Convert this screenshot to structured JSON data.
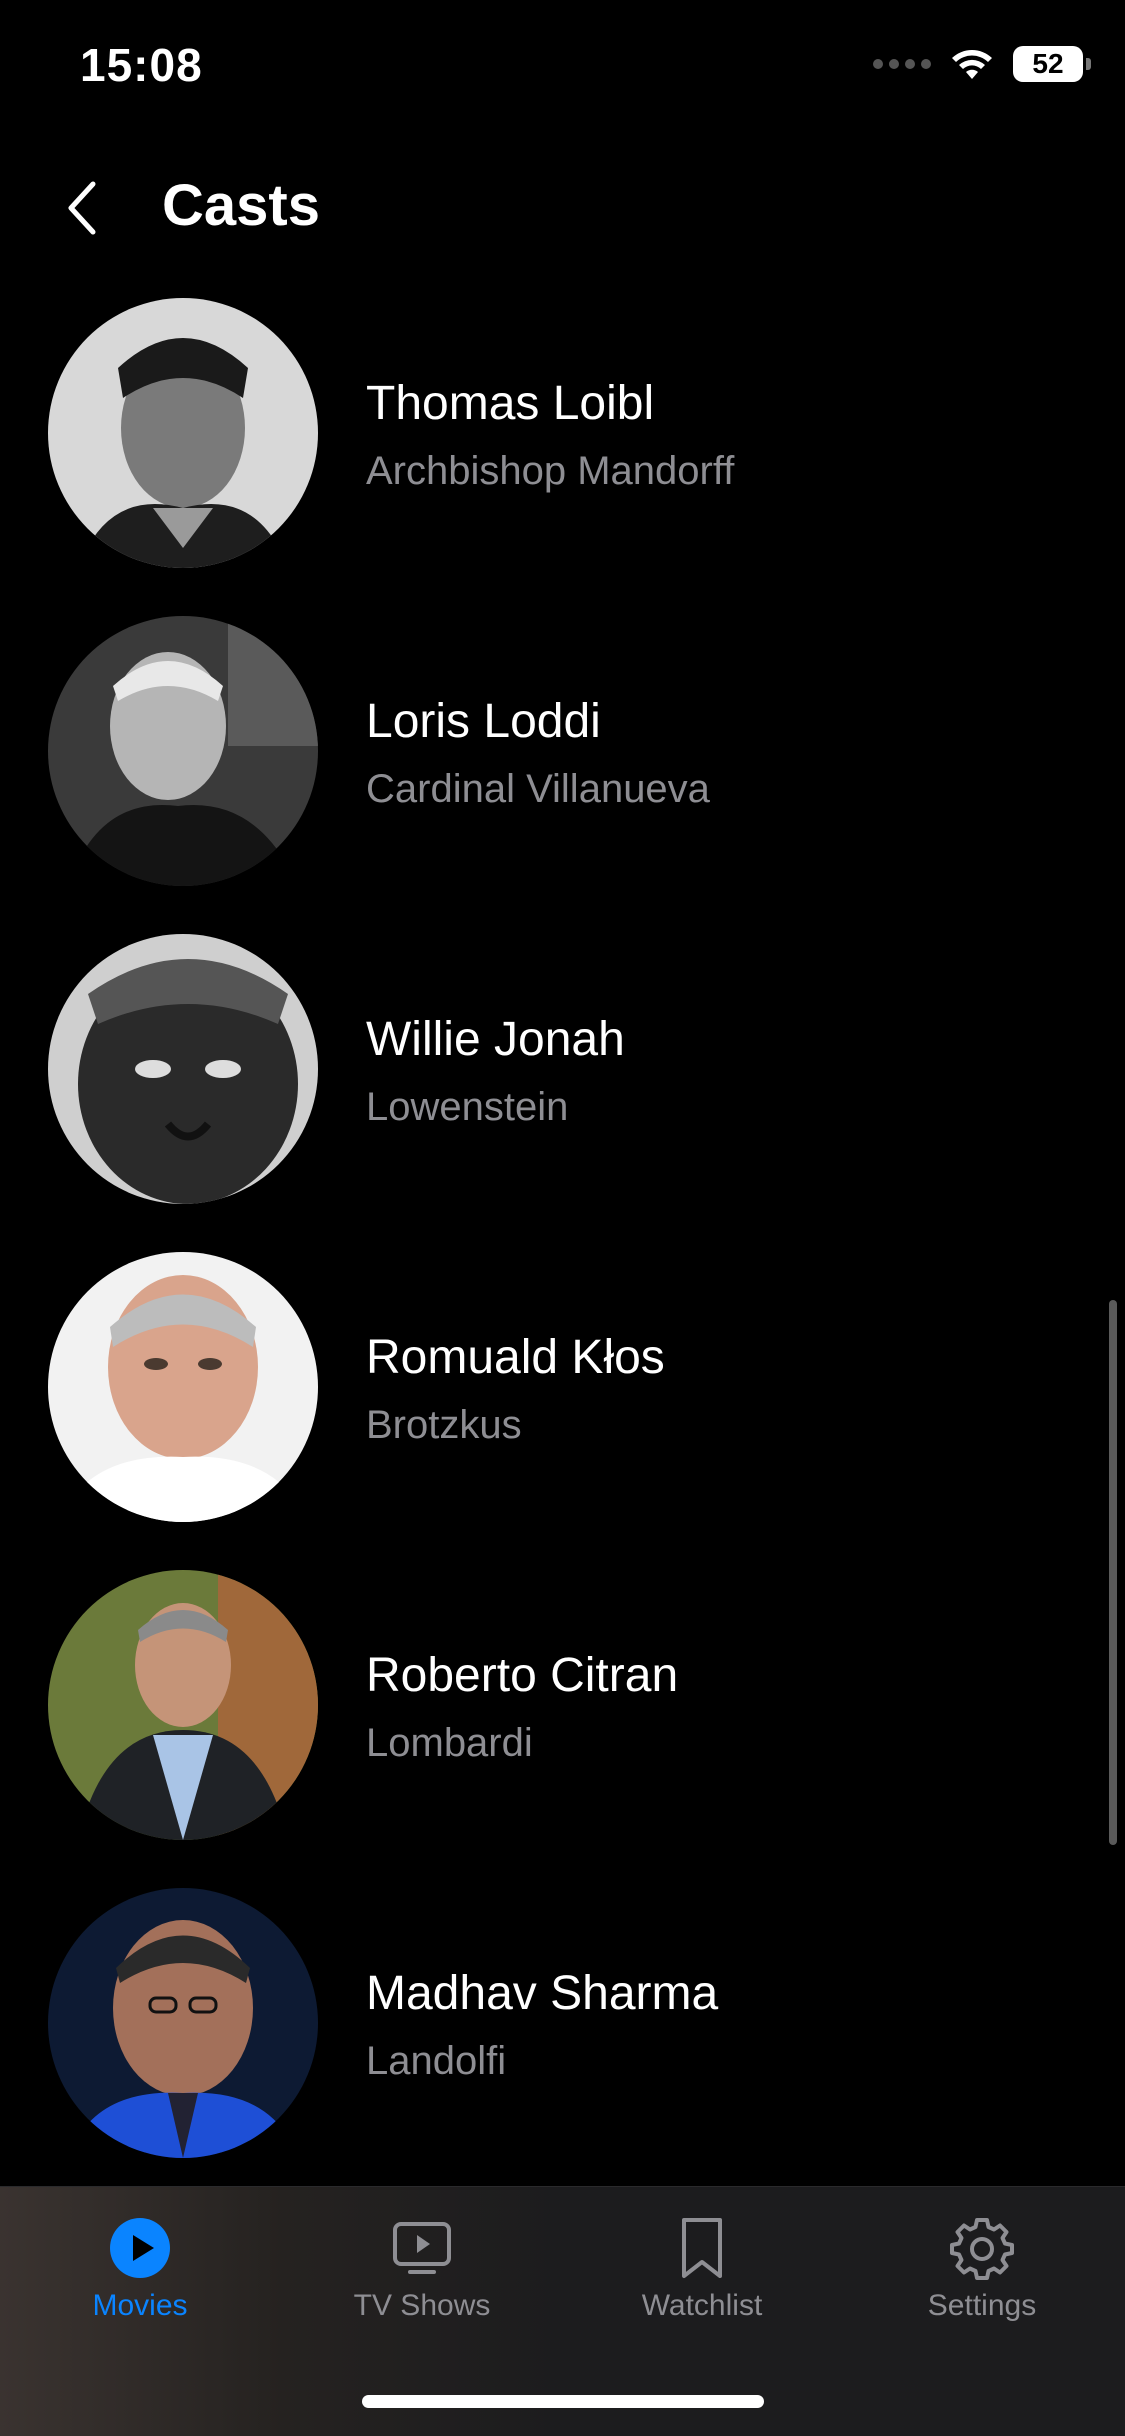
{
  "status": {
    "time": "15:08",
    "battery": "52"
  },
  "header": {
    "title": "Casts"
  },
  "cast": [
    {
      "name": "Thomas Loibl",
      "role": "Archbishop Mandorff"
    },
    {
      "name": "Loris Loddi",
      "role": "Cardinal Villanueva"
    },
    {
      "name": "Willie Jonah",
      "role": "Lowenstein"
    },
    {
      "name": "Romuald Kłos",
      "role": "Brotzkus"
    },
    {
      "name": "Roberto Citran",
      "role": "Lombardi"
    },
    {
      "name": "Madhav Sharma",
      "role": "Landolfi"
    }
  ],
  "tabs": [
    {
      "label": "Movies",
      "icon": "play-circle-icon",
      "active": true
    },
    {
      "label": "TV Shows",
      "icon": "tv-play-icon",
      "active": false
    },
    {
      "label": "Watchlist",
      "icon": "bookmark-icon",
      "active": false
    },
    {
      "label": "Settings",
      "icon": "gear-icon",
      "active": false
    }
  ],
  "colors": {
    "accent": "#0a84ff",
    "secondary_text": "#8e8e93",
    "background": "#000000"
  }
}
